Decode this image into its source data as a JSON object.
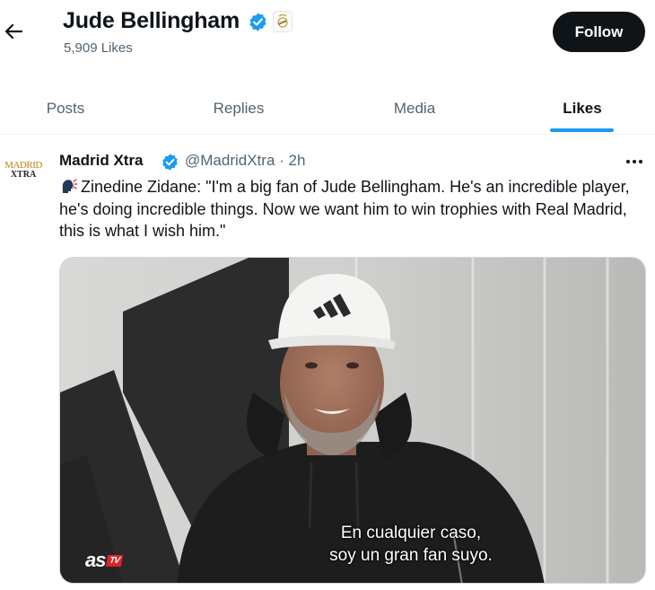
{
  "header": {
    "profile_name": "Jude Bellingham",
    "likes_count": "5,909 Likes",
    "follow_label": "Follow"
  },
  "tabs": [
    {
      "label": "Posts",
      "active": false
    },
    {
      "label": "Replies",
      "active": false
    },
    {
      "label": "Media",
      "active": false
    },
    {
      "label": "Likes",
      "active": true
    }
  ],
  "tweet": {
    "avatar_line1": "MADRID",
    "avatar_line2": "XTRA",
    "author": "Madrid Xtra",
    "handle_time": "@MadridXtra · 2h",
    "text": "Zinedine Zidane: \"I'm a big fan of Jude Bellingham. He's an incredible player, he's doing incredible things. Now we want him to win trophies with Real Madrid, this is what I wish him.\"",
    "emoji": "speaking-head",
    "media": {
      "subtitle_line1": "En cualquier caso,",
      "subtitle_line2": "soy un gran fan suyo.",
      "watermark_as": "as",
      "watermark_tv": "TV"
    }
  },
  "colors": {
    "accent": "#1d9bf0",
    "text": "#0f1419",
    "muted": "#536471",
    "button_bg": "#0f1419"
  },
  "icons": [
    "back-arrow-icon",
    "verified-badge-icon",
    "real-madrid-crest-icon",
    "more-icon",
    "speaking-head-emoji-icon"
  ]
}
